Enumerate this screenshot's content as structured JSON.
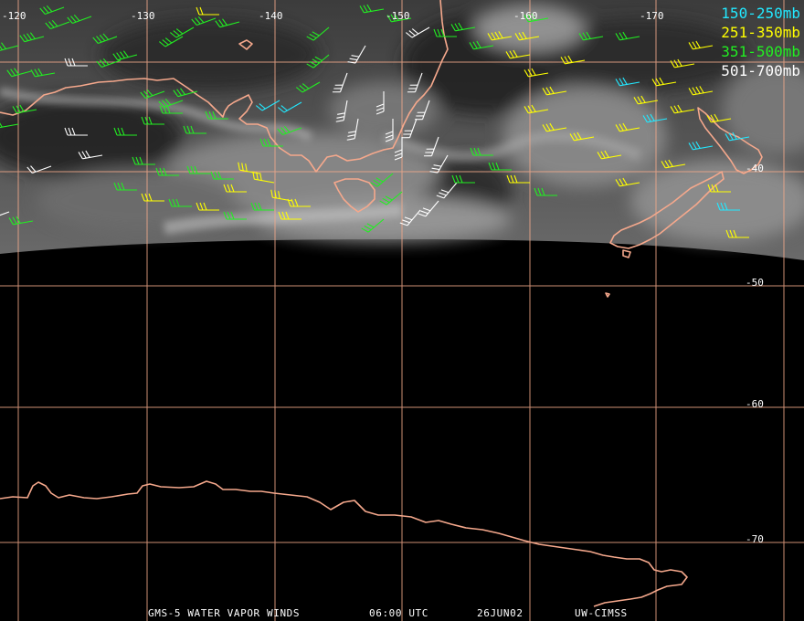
{
  "colors": {
    "grid": "#f2a98a",
    "coast": "#f5a88c",
    "level_150_250": "#22e8ff",
    "level_251_350": "#ffff00",
    "level_351_500": "#22ee22",
    "level_501_700": "#ffffff"
  },
  "lon_labels": [
    "-120",
    "-130",
    "-140",
    "-150",
    "-160",
    "-170"
  ],
  "lat_labels": [
    "-40",
    "-50",
    "-60",
    "-70"
  ],
  "legend": [
    {
      "label": "150-250mb",
      "color": "#22e8ff"
    },
    {
      "label": "251-350mb",
      "color": "#ffff00"
    },
    {
      "label": "351-500mb",
      "color": "#22ee22"
    },
    {
      "label": "501-700mb",
      "color": "#ffffff"
    }
  ],
  "footer": {
    "satellite": "GMS-5 WATER VAPOR WINDS",
    "time": "06:00 UTC",
    "date": "26JUN02",
    "source": "UW-CIMSS"
  }
}
